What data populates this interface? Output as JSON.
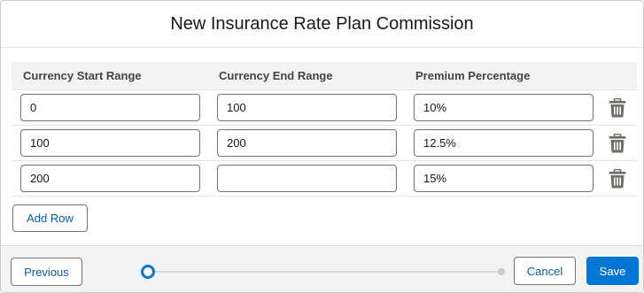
{
  "modal": {
    "title": "New Insurance Rate Plan Commission"
  },
  "table": {
    "columns": [
      "Currency Start Range",
      "Currency End Range",
      "Premium Percentage"
    ],
    "rows": [
      {
        "start": "0",
        "end": "100",
        "percentage": "10%"
      },
      {
        "start": "100",
        "end": "200",
        "percentage": "12.5%"
      },
      {
        "start": "200",
        "end": "",
        "percentage": "15%"
      }
    ],
    "row_action_icon": "trash-icon"
  },
  "actions": {
    "add_row_label": "Add Row"
  },
  "footer": {
    "previous_label": "Previous",
    "cancel_label": "Cancel",
    "save_label": "Save",
    "progress": {
      "current_step": 1,
      "total_steps": 2
    }
  },
  "colors": {
    "brand": "#0176d3",
    "link": "#0b5cab",
    "icon": "#706e6b"
  }
}
